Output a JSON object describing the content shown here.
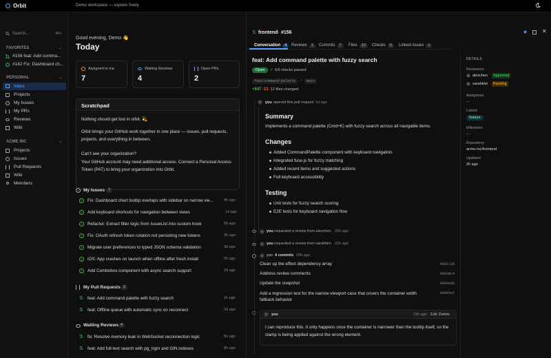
{
  "app": {
    "name": "Orbit"
  },
  "topbar": {
    "workspace": "Demo workspace — explore freely"
  },
  "sidebar": {
    "search_placeholder": "Search...",
    "search_shortcut": "⌘K",
    "favorites_label": "FAVORITES",
    "favorites": [
      "#156 feat: Add comma...",
      "#142 Fix: Dashboard ch..."
    ],
    "personal_label": "PERSONAL",
    "personal": [
      "Inbox",
      "Projects",
      "My Issues",
      "My PRs",
      "Reviews",
      "Wiki"
    ],
    "org_label": "ACME INC",
    "org": [
      "Projects",
      "Issues",
      "Pull Requests",
      "Wiki",
      "Members"
    ]
  },
  "home": {
    "greeting": "Good evening, Demo 👋",
    "title": "Today",
    "stats": [
      {
        "label": "Assigned to me",
        "value": "7"
      },
      {
        "label": "Waiting Reviews",
        "value": "4"
      },
      {
        "label": "Open PRs",
        "value": "2"
      }
    ],
    "scratchpad": {
      "title": "Scratchpad",
      "p1": "Nothing should get lost in orbit. 💫",
      "p2": "Orbit brings your GitHub work together in one place — issues, pull requests, projects, and everything in between.",
      "p3a": "Can't see your organization?",
      "p3b": "Your GitHub account may need additional access. Connect a Personal Access Token (PAT) to bring your organization into Orbit."
    },
    "my_issues": {
      "title": "My Issues",
      "count": "7",
      "items": [
        {
          "title": "Fix: Dashboard chart tooltip overlaps with sidebar on narrow vie...",
          "time": "4h ago"
        },
        {
          "title": "Add keyboard shortcuts for navigation between views",
          "time": "1d ago"
        },
        {
          "title": "Refactor: Extract filter logic from IssueList into custom hook",
          "time": "6h ago"
        },
        {
          "title": "Fix: OAuth refresh token rotation not persisting new tokens",
          "time": "2h ago"
        },
        {
          "title": "Migrate user preferences to typed JSON schema validation",
          "time": "3d ago"
        },
        {
          "title": "iOS: App crashes on launch when offline after fresh install",
          "time": "2h ago"
        },
        {
          "title": "Add Combobox component with async search support",
          "time": "2d ago"
        }
      ]
    },
    "my_prs": {
      "title": "My Pull Requests",
      "count": "2",
      "items": [
        {
          "title": "feat: Add command palette with fuzzy search",
          "time": "2h ago"
        },
        {
          "title": "feat: Offline queue with automatic sync on reconnect",
          "time": "2d ago"
        }
      ]
    },
    "waiting": {
      "title": "Waiting Reviews",
      "count": "4",
      "items": [
        {
          "title": "fix: Resolve memory leak in WebSocket reconnection logic",
          "time": "5h ago"
        },
        {
          "title": "feat: Add full-text search with pg_trgm and GIN indexes",
          "time": "6h ago"
        }
      ]
    }
  },
  "pr": {
    "repo": "frontend",
    "number": "#156",
    "tabs": [
      {
        "label": "Conversation",
        "count": "4"
      },
      {
        "label": "Reviews",
        "count": "1"
      },
      {
        "label": "Commits",
        "count": "7"
      },
      {
        "label": "Files",
        "count": "12"
      },
      {
        "label": "Checks",
        "count": "6"
      },
      {
        "label": "Linked issues",
        "count": "1"
      }
    ],
    "title": "feat: Add command palette with fuzzy search",
    "state": "Open",
    "checks": "6/6 checks passed",
    "branch_from": "feat/command-palette",
    "arrow": "→",
    "branch_to": "main",
    "additions": "+847",
    "deletions": "-23",
    "files_changed": "12 files changed",
    "opened": {
      "user": "you",
      "action": "opened this pull request",
      "time": "1d ago"
    },
    "body": {
      "h_summary": "Summary",
      "summary": "Implements a command palette (Cmd+K) with fuzzy search across all navigable items.",
      "h_changes": "Changes",
      "changes": [
        "Added CommandPalette component with keyboard navigation",
        "Integrated fuse.js for fuzzy matching",
        "Added recent items and suggested actions",
        "Full keyboard accessibility"
      ],
      "h_testing": "Testing",
      "testing": [
        "Unit tests for fuzzy search scoring",
        "E2E tests for keyboard navigation flow"
      ]
    },
    "events": [
      {
        "user": "you",
        "action": "requested a review from alexchen",
        "time": "22h ago"
      },
      {
        "user": "you",
        "action": "requested a review from sarahkim",
        "time": "22h ago"
      }
    ],
    "commits_event": {
      "user": "you",
      "label": "4 commits",
      "time": "20h ago",
      "items": [
        {
          "msg": "Clean up the effect dependency array",
          "sha": "0001730"
        },
        {
          "msg": "Address review comments",
          "sha": "00930c4"
        },
        {
          "msg": "Update the snapshot",
          "sha": "0004a56"
        },
        {
          "msg": "Add a regression test for the narrow-viewport case that covers the container width fallback behavior",
          "sha": "00003e7"
        }
      ]
    },
    "comment": {
      "user": "you",
      "time": "19h ago",
      "edit": "Edit",
      "delete": "Delete",
      "text": "I can reproduce this. It only happens once the container is narrower than the tooltip itself, so the clamp is being applied against the wrong element."
    }
  },
  "details": {
    "title": "DETAILS",
    "reviewers_label": "Reviewers",
    "reviewers": [
      {
        "name": "alexchen",
        "status": "Approved"
      },
      {
        "name": "sarahkim",
        "status": "Pending"
      }
    ],
    "assignees_label": "Assignees",
    "assignees": "—",
    "labels_label": "Labels",
    "label": "feature",
    "milestone_label": "Milestone",
    "milestone": "—",
    "repo_label": "Repository",
    "repo": "acme-inc/frontend",
    "updated_label": "Updated",
    "updated": "2h ago"
  },
  "colors": {
    "accent": "#58a6ff",
    "green": "#3fb950",
    "red": "#f85149",
    "approved": "#3fb950",
    "pending": "#d29922"
  }
}
